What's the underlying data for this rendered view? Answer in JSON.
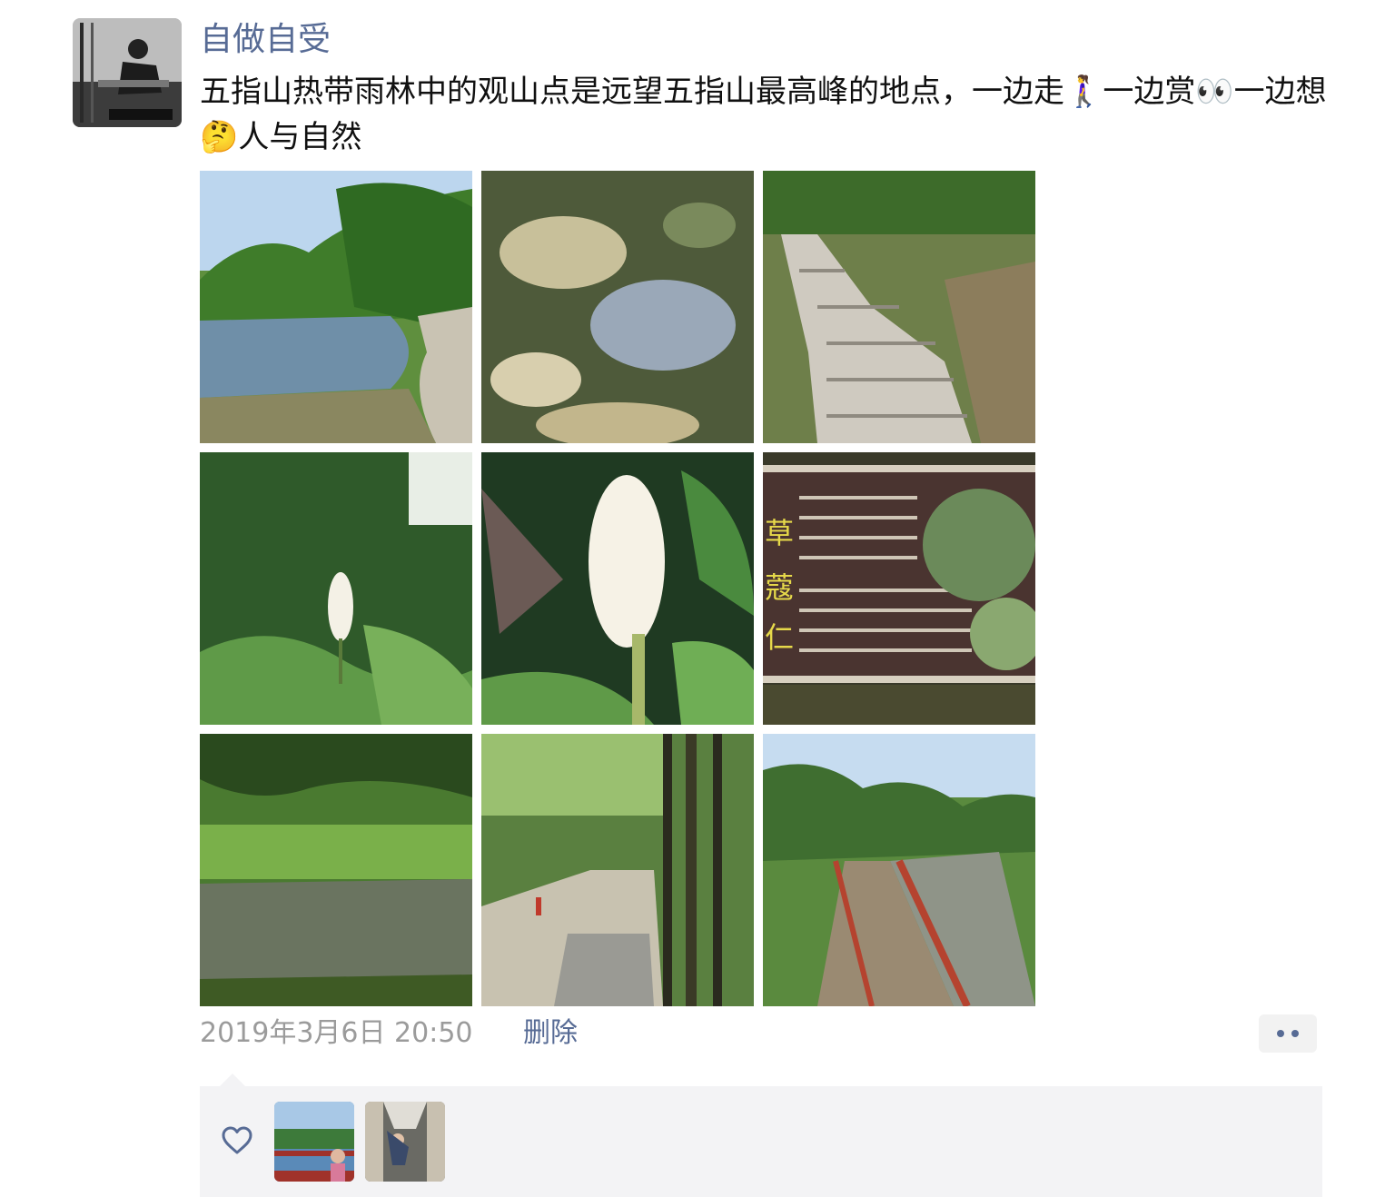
{
  "post": {
    "author_name": "自做自受",
    "text": "五指山热带雨林中的观山点是远望五指山最高峰的地点，一边走🚶‍♀️一边赏👀一边想🤔人与自然",
    "photos": [
      {
        "icon": "photo-river-path"
      },
      {
        "icon": "photo-water-reflection"
      },
      {
        "icon": "photo-stone-steps"
      },
      {
        "icon": "photo-ginger-plant"
      },
      {
        "icon": "photo-white-flower-closeup"
      },
      {
        "icon": "photo-plant-sign"
      },
      {
        "icon": "photo-pond-trees"
      },
      {
        "icon": "photo-forest-trail"
      },
      {
        "icon": "photo-boardwalk-stream"
      }
    ],
    "timestamp": "2019年3月6日 20:50",
    "delete_label": "删除"
  },
  "likes": {
    "icon": "heart-outline-icon",
    "users": [
      {
        "icon": "liker-avatar-1"
      },
      {
        "icon": "liker-avatar-2"
      }
    ]
  },
  "colors": {
    "link": "#576b95",
    "meta": "#9b9b9b",
    "panel": "#f3f3f5"
  }
}
